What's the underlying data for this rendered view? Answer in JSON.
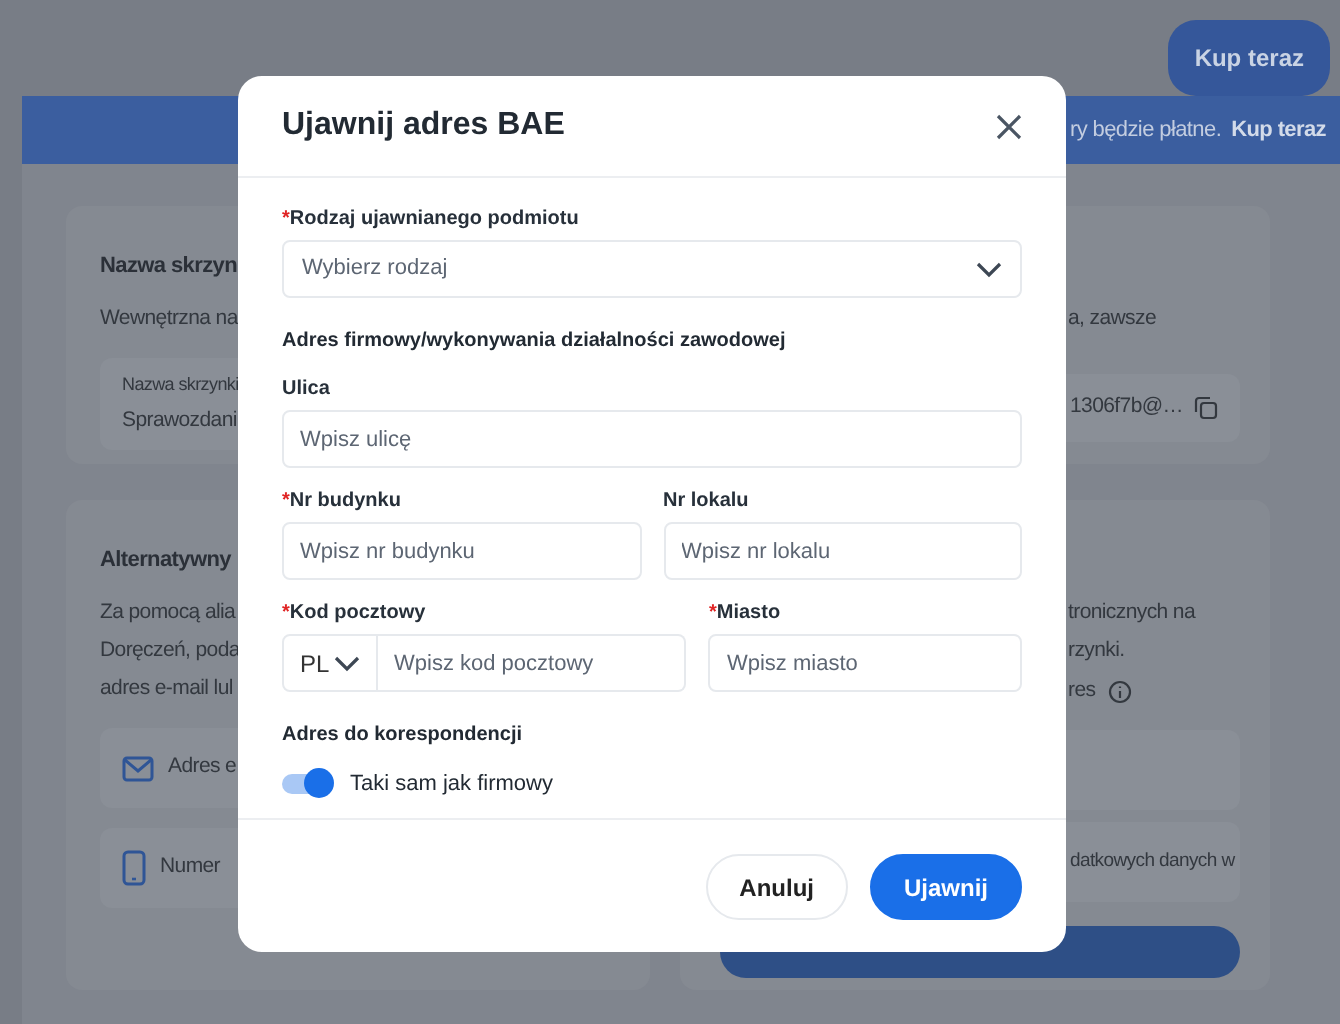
{
  "top_bar": {
    "buy_button": "Kup teraz"
  },
  "banner": {
    "text": "ry będzie płatne.",
    "link": "Kup teraz"
  },
  "left_cards": [
    {
      "title": "Nazwa skrzyn",
      "description": [
        "Wewnętrzna na"
      ],
      "field": {
        "label": "Nazwa skrzynki",
        "value": "Sprawozdani"
      }
    },
    {
      "title": "Alternatywny",
      "description": [
        "Za pomocą alia",
        "Doręczeń, poda",
        "adres e-mail lul"
      ],
      "rows": [
        {
          "kind": "email",
          "text": "Adres e"
        },
        {
          "kind": "phone",
          "text": "Numer"
        }
      ]
    }
  ],
  "right_cards": [
    {
      "description": [
        "a, zawsze"
      ],
      "address": "1306f7b@…"
    },
    {
      "description": [
        "tronicznych na",
        "rzynki."
      ],
      "info_label": "res",
      "rows": [
        "datkowych danych w"
      ]
    }
  ],
  "modal": {
    "title": "Ujawnij adres BAE",
    "type_field": {
      "required_mark": "*",
      "label": "Rodzaj ujawnianego podmiotu",
      "placeholder": "Wybierz rodzaj"
    },
    "section": "Adres firmowy/wykonywania działalności zawodowej",
    "rows": [
      [
        {
          "label": "Ulica",
          "placeholder": "Wpisz ulicę"
        }
      ],
      [
        {
          "required_mark": "*",
          "label": "Nr budynku",
          "placeholder": "Wpisz nr budynku"
        },
        {
          "label": "Nr lokalu",
          "placeholder": "Wpisz nr lokalu"
        }
      ],
      [
        {
          "required_mark": "*",
          "label": "Kod pocztowy",
          "prefix": "PL",
          "placeholder": "Wpisz kod pocztowy"
        },
        {
          "required_mark": "*",
          "label": "Miasto",
          "placeholder": "Wpisz miasto"
        }
      ]
    ],
    "correspondence": {
      "heading": "Adres do korespondencji",
      "label": "Taki sam jak firmowy",
      "on": true
    },
    "buttons": [
      {
        "label": "Anuluj",
        "kind": "secondary"
      },
      {
        "label": "Ujawnij",
        "kind": "primary"
      }
    ]
  }
}
